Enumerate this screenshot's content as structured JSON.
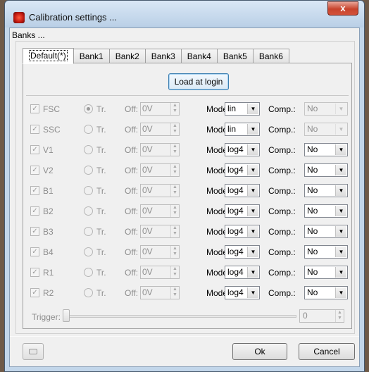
{
  "window": {
    "title": "Calibration settings ...",
    "close_symbol": "x"
  },
  "banks_label": "Banks ...",
  "tabs": [
    "Default(*)",
    "Bank1",
    "Bank2",
    "Bank3",
    "Bank4",
    "Bank5",
    "Bank6"
  ],
  "active_tab": 0,
  "load_button": "Load at login",
  "labels": {
    "tr": "Tr.",
    "off": "Off:",
    "mode": "Mode:",
    "comp": "Comp.:"
  },
  "channels": [
    {
      "name": "FSC",
      "checked": true,
      "radio_selected": true,
      "offset": "0V",
      "mode": "lin",
      "comp": "No",
      "comp_disabled": true
    },
    {
      "name": "SSC",
      "checked": true,
      "radio_selected": false,
      "offset": "0V",
      "mode": "lin",
      "comp": "No",
      "comp_disabled": true
    },
    {
      "name": "V1",
      "checked": true,
      "radio_selected": false,
      "offset": "0V",
      "mode": "log4",
      "comp": "No",
      "comp_disabled": false
    },
    {
      "name": "V2",
      "checked": true,
      "radio_selected": false,
      "offset": "0V",
      "mode": "log4",
      "comp": "No",
      "comp_disabled": false
    },
    {
      "name": "B1",
      "checked": true,
      "radio_selected": false,
      "offset": "0V",
      "mode": "log4",
      "comp": "No",
      "comp_disabled": false
    },
    {
      "name": "B2",
      "checked": true,
      "radio_selected": false,
      "offset": "0V",
      "mode": "log4",
      "comp": "No",
      "comp_disabled": false
    },
    {
      "name": "B3",
      "checked": true,
      "radio_selected": false,
      "offset": "0V",
      "mode": "log4",
      "comp": "No",
      "comp_disabled": false
    },
    {
      "name": "B4",
      "checked": true,
      "radio_selected": false,
      "offset": "0V",
      "mode": "log4",
      "comp": "No",
      "comp_disabled": false
    },
    {
      "name": "R1",
      "checked": true,
      "radio_selected": false,
      "offset": "0V",
      "mode": "log4",
      "comp": "No",
      "comp_disabled": false
    },
    {
      "name": "R2",
      "checked": true,
      "radio_selected": false,
      "offset": "0V",
      "mode": "log4",
      "comp": "No",
      "comp_disabled": false
    }
  ],
  "trigger": {
    "label": "Trigger:",
    "value": "0",
    "slider_fraction": 0
  },
  "buttons": {
    "ok": "Ok",
    "cancel": "Cancel"
  }
}
